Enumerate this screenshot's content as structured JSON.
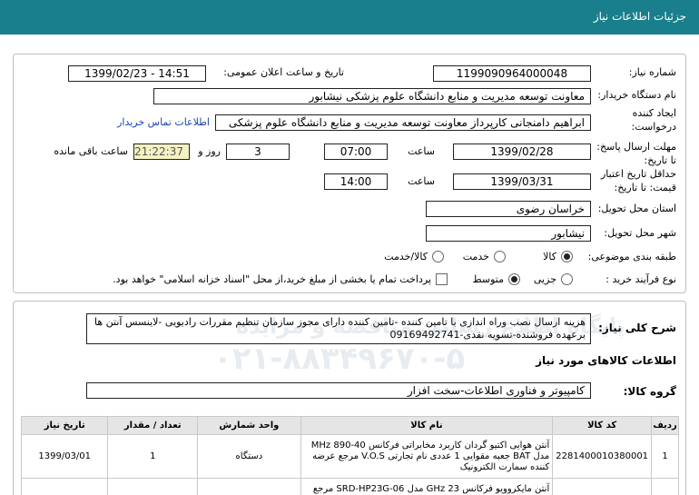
{
  "header": {
    "title": "جزئیات اطلاعات نیاز"
  },
  "form": {
    "need_number_label": "شماره نیاز:",
    "need_number": "1199090964000048",
    "announce_label": "تاریخ و ساعت اعلان عمومی:",
    "announce_value": "1399/02/23 - 14:51",
    "buyer_label": "نام دستگاه خریدار:",
    "buyer_value": "معاونت توسعه مدیریت و منابع دانشگاه علوم پزشکی نیشابور",
    "creator_label_1": "ایجاد کننده",
    "creator_label_2": "درخواست:",
    "creator_value": "ابراهیم دامنجانی  کارپرداز معاونت توسعه مدیریت و منابع دانشگاه علوم پزشکی",
    "contact_link": "اطلاعات تماس خریدار",
    "reply_label_1": "مهلت ارسال پاسخ:",
    "reply_label_2": "تا تاریخ:",
    "reply_date": "1399/02/28",
    "time_label": "ساعت",
    "reply_time": "07:00",
    "days_value": "3",
    "days_label": "روز و",
    "remaining_time": "21:22:37",
    "remaining_label": "ساعت باقی مانده",
    "price_label_1": "حداقل تاریخ اعتبار",
    "price_label_2": "قیمت: تا تاریخ:",
    "price_date": "1399/03/31",
    "price_time_label": "ساعت",
    "price_time": "14:00",
    "province_label": "استان محل تحویل:",
    "province_value": "خراسان رضوی",
    "city_label": "شهر محل تحویل:",
    "city_value": "نیشابور",
    "category_label": "طبقه بندی موضوعی:",
    "category_options": [
      "کالا",
      "خدمت",
      "کالا/خدمت"
    ],
    "category_selected": 0,
    "process_label": "نوع فرآیند خرید :",
    "process_options": [
      "جزیی",
      "متوسط"
    ],
    "process_selected": 1,
    "payment_note": "پرداخت تمام یا بخشی از مبلغ خرید،از محل \"اسناد خزانه اسلامی\" خواهد بود."
  },
  "details": {
    "description_label": "شرح کلی نیاز:",
    "description": "هزینه ارسال نصب وراه اندازی با تامین کننده -تامین کننده دارای مجوز سازمان تنظیم مقررات رادیویی -لاینسس آنتن ها برعهده فروشنده-تسویه نقدی-09169492741",
    "goods_info_label": "اطلاعات کالاهای مورد نیاز",
    "group_label": "گروه کالا:",
    "group_value": "کامپیوتر و فناوری اطلاعات-سخت افزار",
    "table": {
      "headers": [
        "ردیف",
        "کد کالا",
        "نام کالا",
        "واحد شمارش",
        "تعداد / مقدار",
        "تاریخ نیاز"
      ],
      "rows": [
        {
          "index": "1",
          "code": "2281400010380001",
          "name": "آنتن هوایی اکتیو گردان کاربرد مخابراتی فرکانس MHz 890-40 مدل BAT جعبه مقوایی 1 عددی نام تجارتی V.O.S مرجع عرضه کننده سمارت الکترونیک",
          "unit": "دستگاه",
          "qty": "1",
          "date": "1399/03/01"
        },
        {
          "index": "",
          "code": "",
          "name": "آنتن مایکروویو فرکانس GHz 23 مدل SRD-HP23G-06 مرجع",
          "unit": "",
          "qty": "",
          "date": ""
        }
      ]
    }
  },
  "watermark": {
    "line1": "پایگاه اطلاع رسانی مناقصه و مزایده",
    "line2": "۰۲۱-۸۸۳۴۹۶۷۰-۵"
  },
  "colors": {
    "header_bg": "#1a7f8c",
    "link": "#1a44b3",
    "timer_bg": "#f5f2c2"
  }
}
